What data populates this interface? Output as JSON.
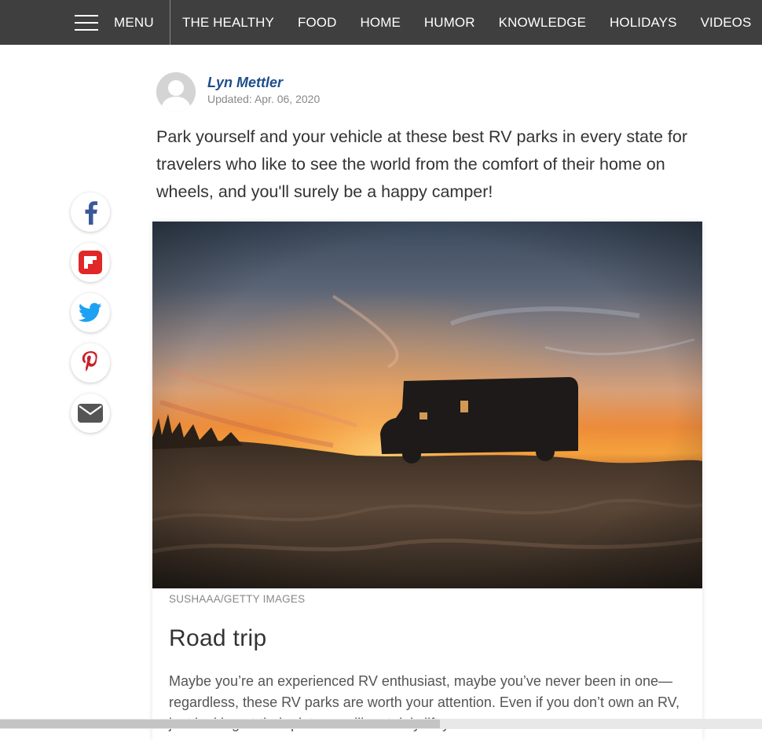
{
  "nav": {
    "menu_label": "MENU",
    "links": [
      "THE HEALTHY",
      "FOOD",
      "HOME",
      "HUMOR",
      "KNOWLEDGE",
      "HOLIDAYS",
      "VIDEOS"
    ]
  },
  "author": {
    "name": "Lyn Mettler",
    "updated": "Updated: Apr. 06, 2020"
  },
  "dek": "Park yourself and your vehicle at these best RV parks in every state for travelers who like to see the world from the comfort of their home on wheels, and you'll surely be a happy camper!",
  "share": {
    "icons": [
      "facebook-icon",
      "flipboard-icon",
      "twitter-icon",
      "pinterest-icon",
      "email-icon"
    ],
    "colors": {
      "facebook": "#3b5998",
      "flipboard": "#e12828",
      "twitter": "#1da1f2",
      "pinterest": "#cb2027",
      "email": "#555555"
    }
  },
  "card": {
    "credit": "SUSHAAA/GETTY IMAGES",
    "title": "Road trip",
    "body": "Maybe you’re an experienced RV enthusiast, maybe you’ve never been in one—regardless, these RV parks are worth your attention. Even if you don’t own an RV, just looking at their pictures will certainly lift your"
  },
  "colors": {
    "nav_bg": "#3f3f3f",
    "author_link": "#1f4e8c"
  }
}
